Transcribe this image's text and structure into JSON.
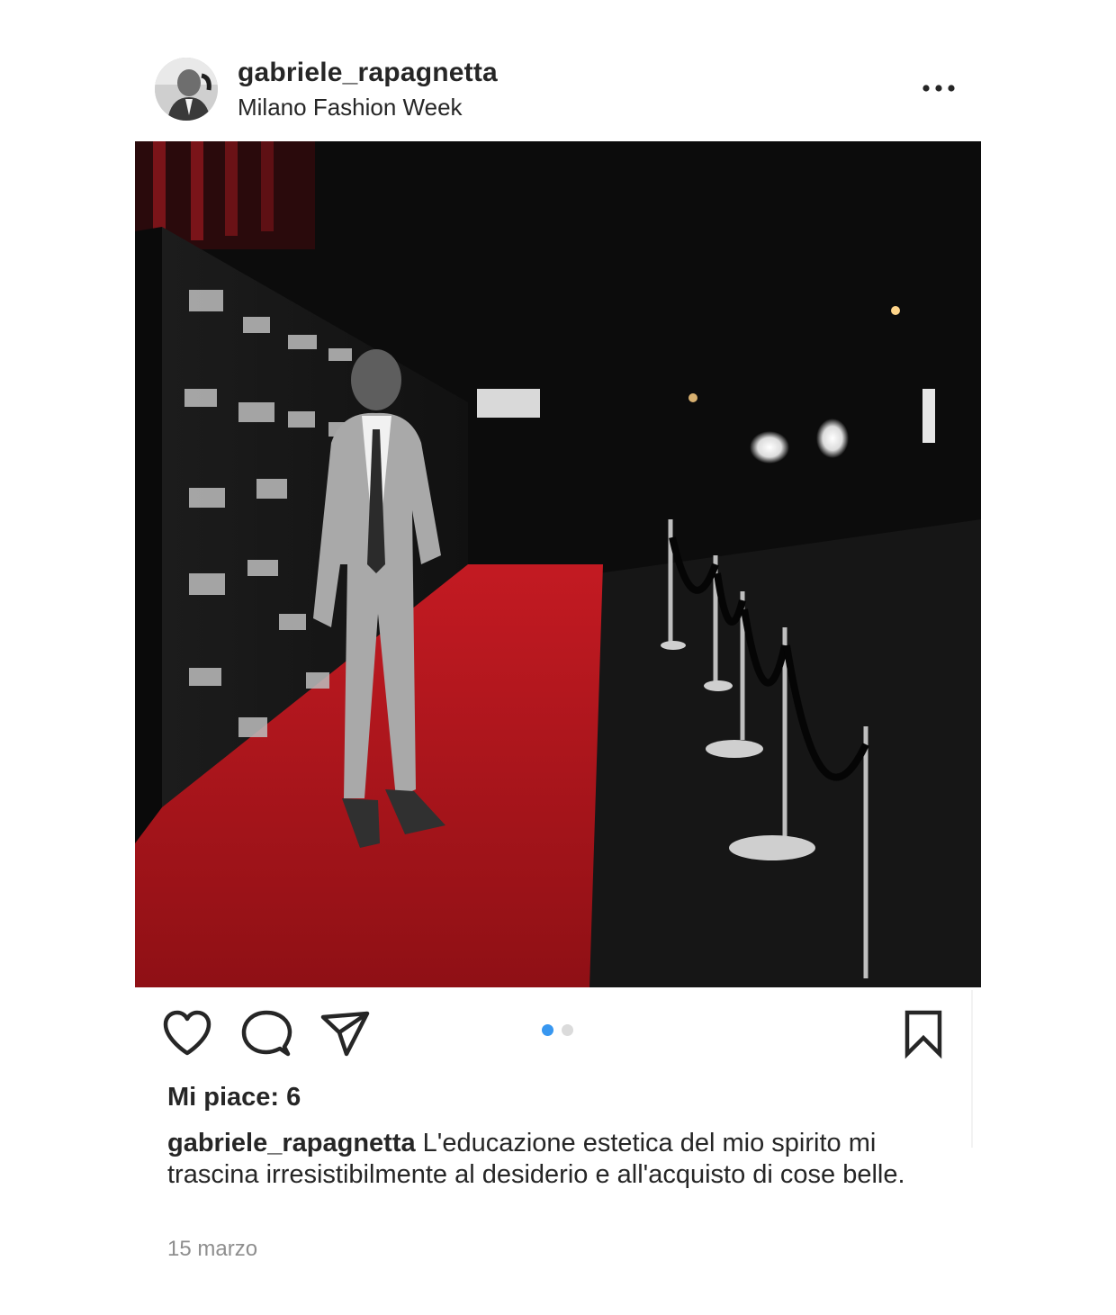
{
  "post": {
    "username": "gabriele_rapagnetta",
    "location": "Milano Fashion Week",
    "likes_text": "Mi piace: 6",
    "caption_username": "gabriele_rapagnetta",
    "caption_text": "L'educazione estetica del mio spirito mi trascina irresistibilmente al desiderio e all'acquisto di cose belle.",
    "date": "15 marzo"
  },
  "carousel": {
    "total": 2,
    "active_index": 1
  },
  "icons": {
    "more": "more-horizontal-icon",
    "like": "heart-icon",
    "comment": "comment-bubble-icon",
    "share": "paper-plane-icon",
    "save": "bookmark-icon"
  },
  "colors": {
    "text": "#262626",
    "secondary_text": "#8e8e8e",
    "carousel_active": "#3897f0",
    "carousel_inactive": "#dbdbdb",
    "carpet_red": "#b0161c"
  }
}
